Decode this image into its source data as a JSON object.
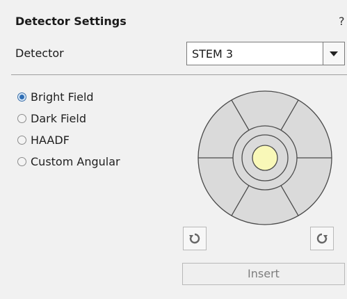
{
  "panel": {
    "title": "Detector Settings",
    "help_label": "?"
  },
  "detector": {
    "label": "Detector",
    "selected": "STEM 3"
  },
  "modes": [
    {
      "label": "Bright Field",
      "checked": true
    },
    {
      "label": "Dark Field",
      "checked": false
    },
    {
      "label": "HAADF",
      "checked": false
    },
    {
      "label": "Custom Angular",
      "checked": false
    }
  ],
  "diagram": {
    "segments_outer": 6,
    "center_fill": "#f9f8b8",
    "ring_fill": "#dadada"
  },
  "buttons": {
    "rotate_left_icon": "rotate-ccw-icon",
    "rotate_right_icon": "rotate-cw-icon",
    "insert_label": "Insert",
    "insert_enabled": false
  }
}
